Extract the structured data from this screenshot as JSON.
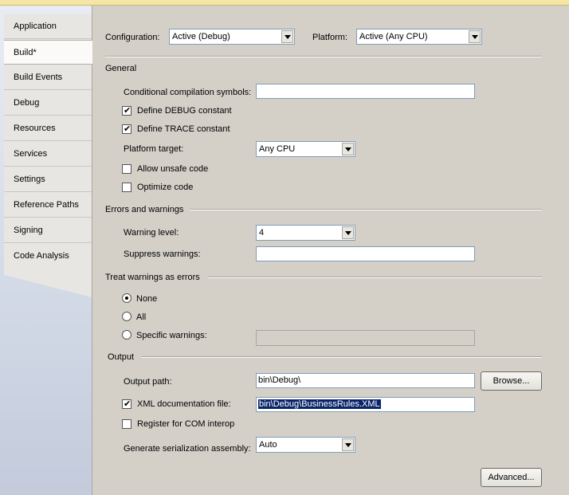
{
  "sidebar": {
    "tabs": [
      {
        "label": "Application"
      },
      {
        "label": "Build*"
      },
      {
        "label": "Build Events"
      },
      {
        "label": "Debug"
      },
      {
        "label": "Resources"
      },
      {
        "label": "Services"
      },
      {
        "label": "Settings"
      },
      {
        "label": "Reference Paths"
      },
      {
        "label": "Signing"
      },
      {
        "label": "Code Analysis"
      }
    ]
  },
  "header": {
    "configuration_label": "Configuration:",
    "configuration_value": "Active (Debug)",
    "platform_label": "Platform:",
    "platform_value": "Active (Any CPU)"
  },
  "general": {
    "title": "General",
    "symbols_label": "Conditional compilation symbols:",
    "symbols_value": "",
    "define_debug_label": "Define DEBUG constant",
    "define_debug_checked": true,
    "define_trace_label": "Define TRACE constant",
    "define_trace_checked": true,
    "platform_target_label": "Platform target:",
    "platform_target_value": "Any CPU",
    "allow_unsafe_label": "Allow unsafe code",
    "allow_unsafe_checked": false,
    "optimize_label": "Optimize code",
    "optimize_checked": false
  },
  "errors": {
    "title": "Errors and warnings",
    "warning_level_label": "Warning level:",
    "warning_level_value": "4",
    "suppress_label": "Suppress warnings:",
    "suppress_value": ""
  },
  "treat": {
    "title": "Treat warnings as errors",
    "none_label": "None",
    "all_label": "All",
    "specific_label": "Specific warnings:",
    "selected": "None",
    "specific_value": ""
  },
  "output": {
    "title": "Output",
    "path_label": "Output path:",
    "path_value": "bin\\Debug\\",
    "browse_label": "Browse...",
    "xml_doc_label": "XML documentation file:",
    "xml_doc_checked": true,
    "xml_doc_value": "bin\\Debug\\BusinessRules.XML",
    "com_interop_label": "Register for COM interop",
    "com_interop_checked": false,
    "serialization_label": "Generate serialization assembly:",
    "serialization_value": "Auto"
  },
  "advanced_label": "Advanced..."
}
